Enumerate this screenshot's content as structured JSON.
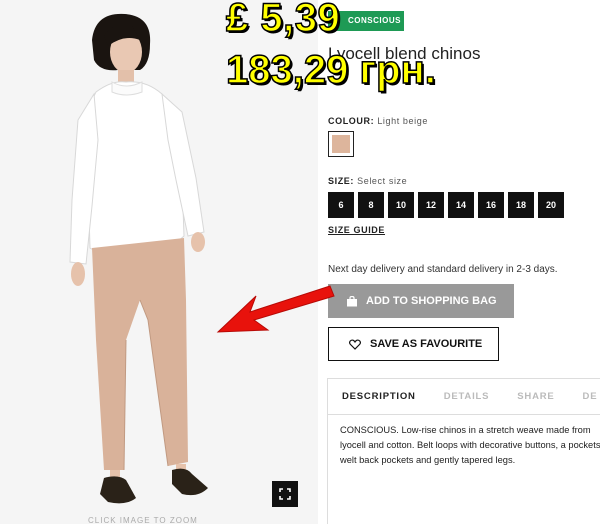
{
  "product": {
    "badge": "CONSCIOUS",
    "title": "Lyocell blend chinos",
    "colour_label": "COLOUR:",
    "colour_value": "Light beige",
    "swatch_color": "#ddb59c",
    "size_label": "SIZE:",
    "size_value": "Select size",
    "sizes": [
      "6",
      "8",
      "10",
      "12",
      "14",
      "16",
      "18",
      "20"
    ],
    "size_guide": "SIZE GUIDE",
    "delivery": "Next day delivery and standard delivery in 2-3 days.",
    "add_to_bag": "ADD TO SHOPPING BAG",
    "save_favourite": "SAVE AS FAVOURITE",
    "click_hint": "CLICK IMAGE TO ZOOM"
  },
  "tabs": [
    "DESCRIPTION",
    "DETAILS",
    "SHARE",
    "DE"
  ],
  "description": "CONSCIOUS. Low-rise chinos in a stretch weave made from lyocell and cotton. Belt loops with decorative buttons, a pockets, welt back pockets and gently tapered legs.",
  "overlay": {
    "price_gbp": "£ 5,39",
    "price_uah": "183,29 грн."
  },
  "colors": {
    "brand_green": "#1e9a55",
    "overlay_yellow": "#ffff00",
    "arrow_red": "#e8120c"
  },
  "icons": [
    "bag-icon",
    "heart-icon",
    "fullscreen-icon",
    "leaf-icon"
  ]
}
